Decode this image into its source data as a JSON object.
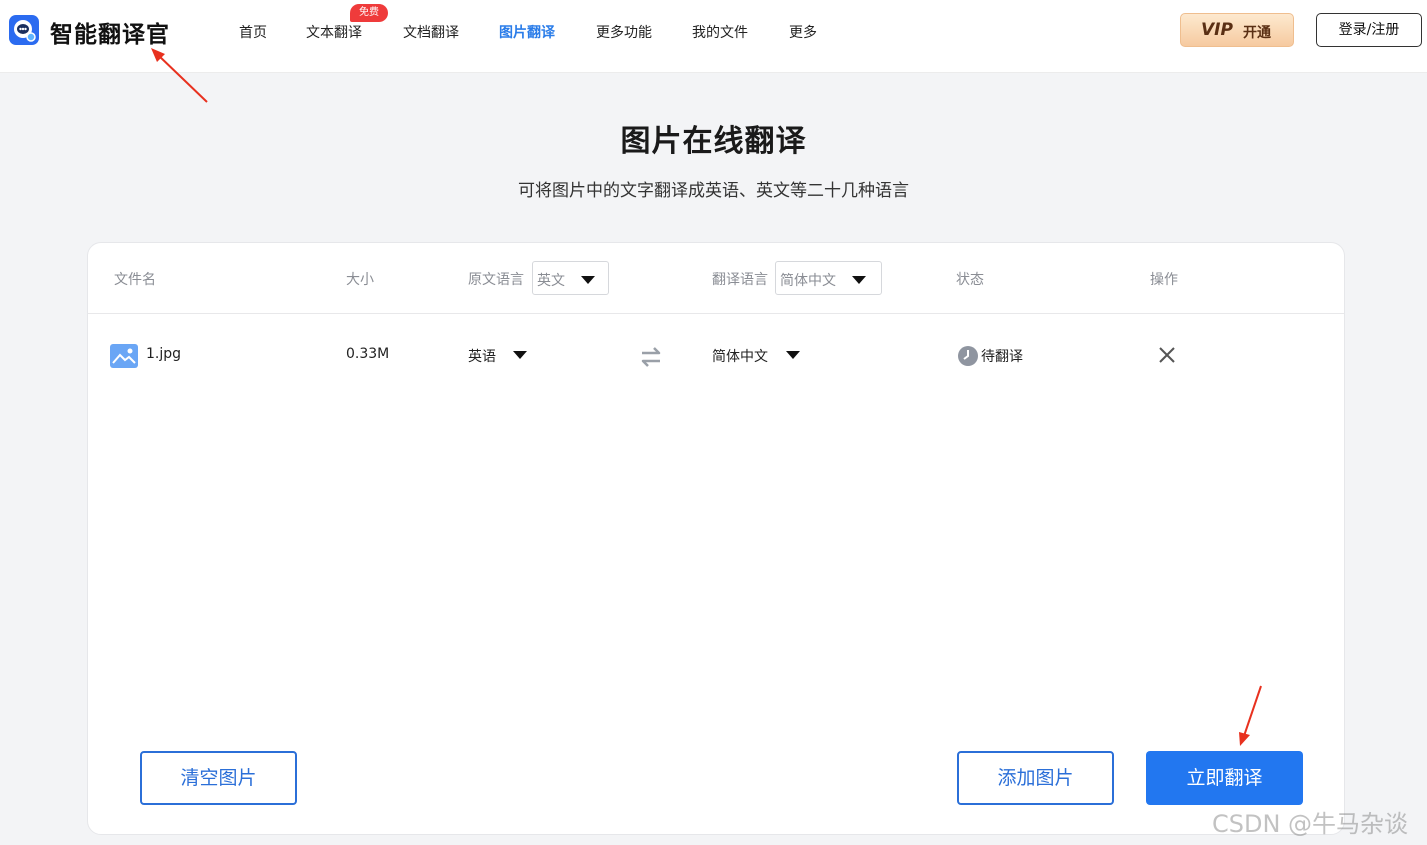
{
  "header": {
    "app_name": "智能翻译官",
    "nav": [
      {
        "label": "首页"
      },
      {
        "label": "文本翻译",
        "badge": "免费"
      },
      {
        "label": "文档翻译"
      },
      {
        "label": "图片翻译",
        "active": true
      },
      {
        "label": "更多功能"
      },
      {
        "label": "我的文件"
      },
      {
        "label": "更多"
      }
    ],
    "vip_logo": "VIP",
    "vip_label": "开通",
    "login_label": "登录/注册"
  },
  "main": {
    "title": "图片在线翻译",
    "subtitle": "可将图片中的文字翻译成英语、英文等二十几种语言"
  },
  "table": {
    "headers": {
      "filename": "文件名",
      "size": "大小",
      "source_lang": "原文语言",
      "target_lang": "翻译语言",
      "status": "状态",
      "action": "操作"
    },
    "source_select": "英文",
    "target_select": "简体中文",
    "rows": [
      {
        "filename": "1.jpg",
        "size": "0.33M",
        "source_lang": "英语",
        "target_lang": "简体中文",
        "status": "待翻译"
      }
    ]
  },
  "buttons": {
    "clear": "清空图片",
    "add": "添加图片",
    "translate": "立即翻译"
  },
  "watermark": "CSDN @牛马杂谈",
  "colors": {
    "accent": "#2277f0",
    "active_nav": "#2b7de9",
    "badge": "#ef3b3b",
    "annotation_arrow": "#e8311f"
  }
}
